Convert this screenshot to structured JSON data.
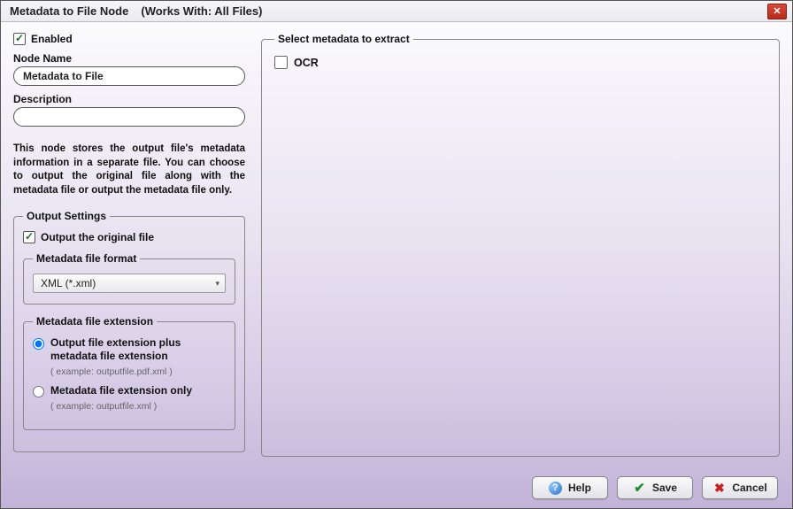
{
  "title_main": "Metadata to File Node",
  "title_sub": "(Works With: All Files)",
  "enabled": {
    "label": "Enabled",
    "checked": true
  },
  "nodeName": {
    "label": "Node Name",
    "value": "Metadata to File"
  },
  "description": {
    "label": "Description",
    "value": ""
  },
  "infoText": "This node stores the output file's metadata information in a separate file. You can choose to output the original file along with the metadata file or output the metadata file only.",
  "outputSettings": {
    "legend": "Output Settings",
    "outputOriginal": {
      "label": "Output the original file",
      "checked": true
    },
    "format": {
      "legend": "Metadata file format",
      "value": "XML (*.xml)"
    },
    "extension": {
      "legend": "Metadata file extension",
      "options": [
        {
          "label": "Output file extension plus metadata file extension",
          "example": "( example: outputfile.pdf.xml )",
          "checked": true
        },
        {
          "label": "Metadata file extension only",
          "example": "( example: outputfile.xml )",
          "checked": false
        }
      ]
    }
  },
  "selectMeta": {
    "legend": "Select metadata to extract",
    "items": [
      {
        "label": "OCR",
        "checked": false
      }
    ]
  },
  "buttons": {
    "help": "Help",
    "save": "Save",
    "cancel": "Cancel"
  }
}
